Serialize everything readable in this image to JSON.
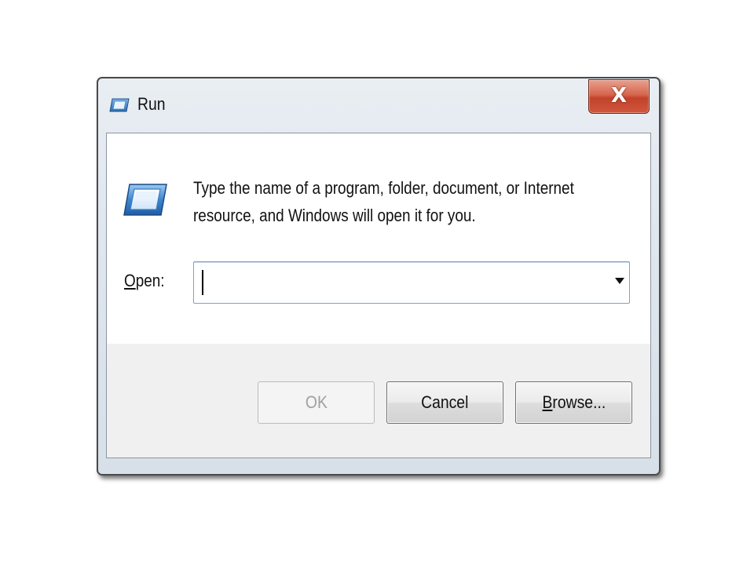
{
  "window": {
    "title": "Run",
    "icon": "run-icon",
    "close_icon": "close-icon",
    "close_glyph": "X"
  },
  "content": {
    "icon": "run-icon",
    "description": "Type the name of a program, folder, document, or Internet\nresource, and Windows will open it for you."
  },
  "open_field": {
    "label_accel": "O",
    "label_rest": "pen:",
    "value": "",
    "dropdown_icon": "chevron-down-icon"
  },
  "buttons": {
    "ok": {
      "label": "OK",
      "enabled": false
    },
    "cancel": {
      "label": "Cancel",
      "enabled": true
    },
    "browse_accel": "B",
    "browse_rest": "rowse..."
  },
  "colors": {
    "close_button": "#c94a32",
    "input_border": "#7fa2c4",
    "disabled_text": "#a0a0a0"
  }
}
